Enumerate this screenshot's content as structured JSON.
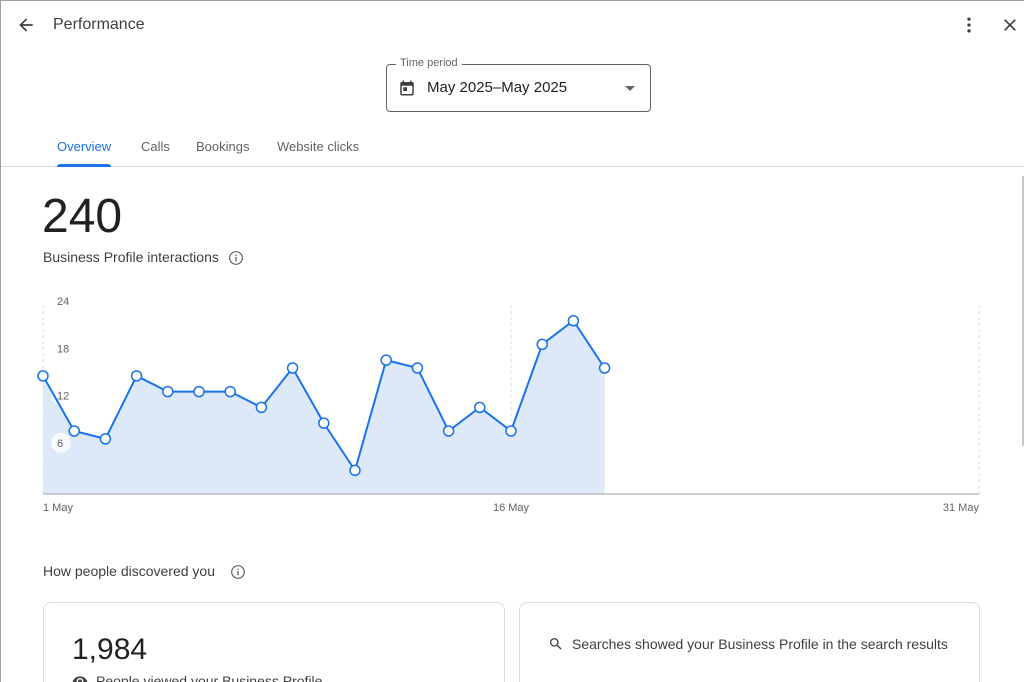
{
  "header": {
    "title": "Performance",
    "back_icon": "arrow-back-icon",
    "more_icon": "more-vert-icon",
    "close_icon": "close-icon"
  },
  "time_period": {
    "label": "Time period",
    "value": "May 2025–May 2025",
    "icon": "calendar-icon"
  },
  "tabs": [
    {
      "label": "Overview",
      "active": true
    },
    {
      "label": "Calls",
      "active": false
    },
    {
      "label": "Bookings",
      "active": false
    },
    {
      "label": "Website clicks",
      "active": false
    }
  ],
  "summary": {
    "total": "240",
    "label": "Business Profile interactions"
  },
  "chart_data": {
    "type": "area",
    "x": [
      "1 May",
      "2 May",
      "3 May",
      "4 May",
      "5 May",
      "6 May",
      "7 May",
      "8 May",
      "9 May",
      "10 May",
      "11 May",
      "12 May",
      "13 May",
      "14 May",
      "15 May",
      "16 May",
      "17 May",
      "18 May",
      "19 May"
    ],
    "series": [
      {
        "values": [
          15,
          8,
          7,
          15,
          13,
          13,
          13,
          11,
          16,
          9,
          3,
          17,
          16,
          8,
          11,
          8,
          19,
          22,
          16
        ]
      }
    ],
    "y_ticks": [
      "24",
      "18",
      "12",
      "6"
    ],
    "x_ticks": [
      "1 May",
      "16 May",
      "31 May"
    ],
    "ylim": [
      0,
      24
    ],
    "xlim_days": [
      1,
      31
    ],
    "line_color": "#1a73e8",
    "fill_color": "#dde9f8"
  },
  "discovery": {
    "title": "How people discovered you",
    "views_total": "1,984",
    "views_label": "People viewed your Business Profile",
    "searches_label": "Searches showed your Business Profile in the search results"
  }
}
